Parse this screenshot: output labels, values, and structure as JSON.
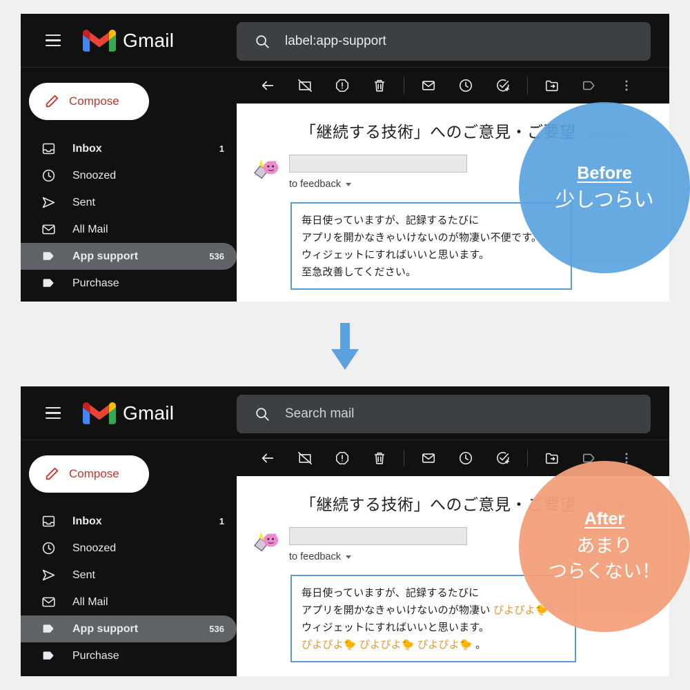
{
  "page": {
    "background": "#f0f0f0",
    "accent_before": "#5ba3e0",
    "accent_after": "#f3a07a",
    "msgbox_border": "#5b9bd5",
    "piyo_color": "#e8982f"
  },
  "arrow": {
    "name": "down-arrow",
    "color": "#5ba3e0"
  },
  "panels": [
    {
      "id": "before",
      "header": {
        "menu_icon": "hamburger-icon",
        "logo_icon": "gmail-logo-icon",
        "brand": "Gmail",
        "search": {
          "icon": "search-icon",
          "value": "label:app-support",
          "placeholder": "Search mail",
          "is_placeholder": false
        }
      },
      "compose": {
        "icon": "pencil-icon",
        "label": "Compose"
      },
      "sidebar": {
        "items": [
          {
            "icon": "inbox-icon",
            "label": "Inbox",
            "count": "1",
            "active": false,
            "bold": true
          },
          {
            "icon": "clock-icon",
            "label": "Snoozed",
            "count": "",
            "active": false,
            "bold": false
          },
          {
            "icon": "send-icon",
            "label": "Sent",
            "count": "",
            "active": false,
            "bold": false
          },
          {
            "icon": "mail-icon",
            "label": "All Mail",
            "count": "",
            "active": false,
            "bold": false
          },
          {
            "icon": "label-icon",
            "label": "App support",
            "count": "536",
            "active": true,
            "bold": true
          },
          {
            "icon": "label-icon",
            "label": "Purchase",
            "count": "",
            "active": false,
            "bold": false
          }
        ]
      },
      "toolbar": [
        {
          "icon": "back-arrow-icon",
          "name": "back-button"
        },
        {
          "icon": "archive-icon",
          "name": "archive-button"
        },
        {
          "icon": "report-spam-icon",
          "name": "report-spam-button"
        },
        {
          "icon": "trash-icon",
          "name": "delete-button"
        },
        {
          "icon": "separator",
          "name": "toolbar-separator-1"
        },
        {
          "icon": "envelope-icon",
          "name": "mark-unread-button"
        },
        {
          "icon": "clock-icon",
          "name": "snooze-button"
        },
        {
          "icon": "add-task-icon",
          "name": "add-to-tasks-button"
        },
        {
          "icon": "separator",
          "name": "toolbar-separator-2"
        },
        {
          "icon": "move-to-icon",
          "name": "move-to-button"
        },
        {
          "icon": "label-icon",
          "name": "labels-button"
        },
        {
          "icon": "more-vert-icon",
          "name": "more-options-button"
        }
      ],
      "mail": {
        "subject": "「継続する技術」へのご意見・ご要望",
        "label_chip": "App supp",
        "avatar_icon": "pink-creature-avatar",
        "sender_redacted": "",
        "to_line": "to feedback",
        "body_lines": [
          [
            {
              "text": "毎日使っていますが、記録するたびに",
              "highlight": false
            }
          ],
          [
            {
              "text": "アプリを開かなきゃいけないのが物凄い不便です。",
              "highlight": false
            }
          ],
          [
            {
              "text": "ウィジェットにすればいいと思います。",
              "highlight": false
            }
          ],
          [
            {
              "text": "至急改善してください。",
              "highlight": false
            }
          ]
        ]
      },
      "badge": {
        "title": "Before",
        "subtitle": "少しつらい"
      }
    },
    {
      "id": "after",
      "header": {
        "menu_icon": "hamburger-icon",
        "logo_icon": "gmail-logo-icon",
        "brand": "Gmail",
        "search": {
          "icon": "search-icon",
          "value": "Search mail",
          "placeholder": "Search mail",
          "is_placeholder": true
        }
      },
      "compose": {
        "icon": "pencil-icon",
        "label": "Compose"
      },
      "sidebar": {
        "items": [
          {
            "icon": "inbox-icon",
            "label": "Inbox",
            "count": "1",
            "active": false,
            "bold": true
          },
          {
            "icon": "clock-icon",
            "label": "Snoozed",
            "count": "",
            "active": false,
            "bold": false
          },
          {
            "icon": "send-icon",
            "label": "Sent",
            "count": "",
            "active": false,
            "bold": false
          },
          {
            "icon": "mail-icon",
            "label": "All Mail",
            "count": "",
            "active": false,
            "bold": false
          },
          {
            "icon": "label-icon",
            "label": "App support",
            "count": "536",
            "active": true,
            "bold": true
          },
          {
            "icon": "label-icon",
            "label": "Purchase",
            "count": "",
            "active": false,
            "bold": false
          }
        ]
      },
      "toolbar": [
        {
          "icon": "back-arrow-icon",
          "name": "back-button"
        },
        {
          "icon": "archive-icon",
          "name": "archive-button"
        },
        {
          "icon": "report-spam-icon",
          "name": "report-spam-button"
        },
        {
          "icon": "trash-icon",
          "name": "delete-button"
        },
        {
          "icon": "separator",
          "name": "toolbar-separator-1"
        },
        {
          "icon": "envelope-icon",
          "name": "mark-unread-button"
        },
        {
          "icon": "clock-icon",
          "name": "snooze-button"
        },
        {
          "icon": "add-task-icon",
          "name": "add-to-tasks-button"
        },
        {
          "icon": "separator",
          "name": "toolbar-separator-2"
        },
        {
          "icon": "move-to-icon",
          "name": "move-to-button"
        },
        {
          "icon": "label-icon",
          "name": "labels-button"
        },
        {
          "icon": "more-vert-icon",
          "name": "more-options-button"
        }
      ],
      "mail": {
        "subject": "「継続する技術」へのご意見・ご要望",
        "label_chip": "App supp",
        "avatar_icon": "pink-creature-avatar",
        "sender_redacted": "",
        "to_line": "to feedback",
        "body_lines": [
          [
            {
              "text": "毎日使っていますが、記録するたびに",
              "highlight": false
            }
          ],
          [
            {
              "text": "アプリを開かなきゃいけないのが物凄い ",
              "highlight": false
            },
            {
              "text": "ぴよぴよ🐤",
              "highlight": true
            },
            {
              "text": " 。",
              "highlight": false
            }
          ],
          [
            {
              "text": "ウィジェットにすればいいと思います。",
              "highlight": false
            }
          ],
          [
            {
              "text": "ぴよぴよ🐤 ぴよぴよ🐤 ぴよぴよ🐤",
              "highlight": true
            },
            {
              "text": " 。",
              "highlight": false
            }
          ]
        ]
      },
      "badge": {
        "title": "After",
        "subtitle": "あまり\nつらくない！"
      }
    }
  ]
}
